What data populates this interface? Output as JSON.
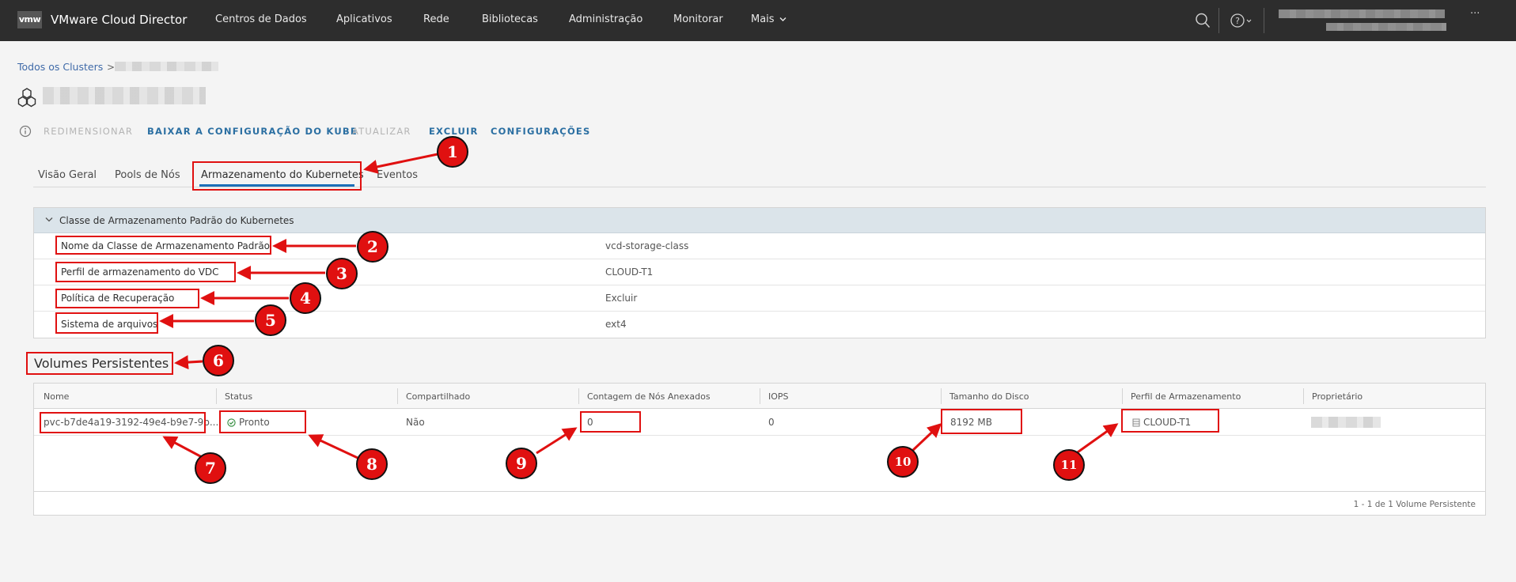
{
  "header": {
    "logo": "vmw",
    "title": "VMware Cloud Director",
    "nav": [
      "Centros de Dados",
      "Aplicativos",
      "Rede",
      "Bibliotecas",
      "Administração",
      "Monitorar"
    ],
    "more": "Mais",
    "user_suffix": "···"
  },
  "breadcrumb": {
    "root": "Todos os Clusters",
    "separator": ">"
  },
  "actions": [
    {
      "label": "REDIMENSIONAR",
      "enabled": false
    },
    {
      "label": "BAIXAR A CONFIGURAÇÃO DO KUBE",
      "enabled": true
    },
    {
      "label": "ATUALIZAR",
      "enabled": false
    },
    {
      "label": "EXCLUIR",
      "enabled": true
    },
    {
      "label": "CONFIGURAÇÕES",
      "enabled": true
    }
  ],
  "tabs": [
    "Visão Geral",
    "Pools de Nós",
    "Armazenamento do Kubernetes",
    "Eventos"
  ],
  "active_tab": "Armazenamento do Kubernetes",
  "storage_class": {
    "title": "Classe de Armazenamento Padrão do Kubernetes",
    "rows": [
      {
        "key": "Nome da Classe de Armazenamento Padrão",
        "value": "vcd-storage-class"
      },
      {
        "key": "Perfil de armazenamento do VDC",
        "value": "CLOUD-T1"
      },
      {
        "key": "Política de Recuperação",
        "value": "Excluir"
      },
      {
        "key": "Sistema de arquivos",
        "value": "ext4"
      }
    ]
  },
  "volumes": {
    "title": "Volumes Persistentes",
    "columns": [
      "Nome",
      "Status",
      "Compartilhado",
      "Contagem de Nós Anexados",
      "IOPS",
      "Tamanho do Disco",
      "Perfil de Armazenamento",
      "Proprietário"
    ],
    "rows": [
      {
        "name": "pvc-b7de4a19-3192-49e4-b9e7-9b...",
        "status": "Pronto",
        "shared": "Não",
        "attached": "0",
        "iops": "0",
        "size": "8192 MB",
        "profile": "CLOUD-T1"
      }
    ],
    "footer": "1 - 1 de 1 Volume Persistente"
  },
  "annotations": [
    "1",
    "2",
    "3",
    "4",
    "5",
    "6",
    "7",
    "8",
    "9",
    "10",
    "11"
  ],
  "colors": {
    "nav_bg": "#2d2d2d",
    "link": "#2b6fa2",
    "annotation": "#e01010",
    "status_ok": "#2f8a3a"
  }
}
